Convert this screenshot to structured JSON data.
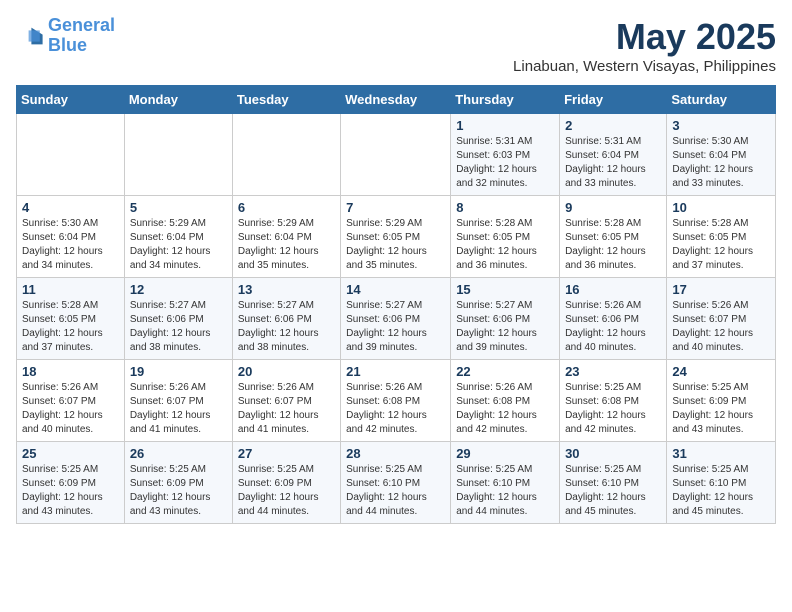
{
  "logo": {
    "line1": "General",
    "line2": "Blue"
  },
  "title": "May 2025",
  "subtitle": "Linabuan, Western Visayas, Philippines",
  "weekdays": [
    "Sunday",
    "Monday",
    "Tuesday",
    "Wednesday",
    "Thursday",
    "Friday",
    "Saturday"
  ],
  "weeks": [
    [
      {
        "day": "",
        "info": ""
      },
      {
        "day": "",
        "info": ""
      },
      {
        "day": "",
        "info": ""
      },
      {
        "day": "",
        "info": ""
      },
      {
        "day": "1",
        "info": "Sunrise: 5:31 AM\nSunset: 6:03 PM\nDaylight: 12 hours\nand 32 minutes."
      },
      {
        "day": "2",
        "info": "Sunrise: 5:31 AM\nSunset: 6:04 PM\nDaylight: 12 hours\nand 33 minutes."
      },
      {
        "day": "3",
        "info": "Sunrise: 5:30 AM\nSunset: 6:04 PM\nDaylight: 12 hours\nand 33 minutes."
      }
    ],
    [
      {
        "day": "4",
        "info": "Sunrise: 5:30 AM\nSunset: 6:04 PM\nDaylight: 12 hours\nand 34 minutes."
      },
      {
        "day": "5",
        "info": "Sunrise: 5:29 AM\nSunset: 6:04 PM\nDaylight: 12 hours\nand 34 minutes."
      },
      {
        "day": "6",
        "info": "Sunrise: 5:29 AM\nSunset: 6:04 PM\nDaylight: 12 hours\nand 35 minutes."
      },
      {
        "day": "7",
        "info": "Sunrise: 5:29 AM\nSunset: 6:05 PM\nDaylight: 12 hours\nand 35 minutes."
      },
      {
        "day": "8",
        "info": "Sunrise: 5:28 AM\nSunset: 6:05 PM\nDaylight: 12 hours\nand 36 minutes."
      },
      {
        "day": "9",
        "info": "Sunrise: 5:28 AM\nSunset: 6:05 PM\nDaylight: 12 hours\nand 36 minutes."
      },
      {
        "day": "10",
        "info": "Sunrise: 5:28 AM\nSunset: 6:05 PM\nDaylight: 12 hours\nand 37 minutes."
      }
    ],
    [
      {
        "day": "11",
        "info": "Sunrise: 5:28 AM\nSunset: 6:05 PM\nDaylight: 12 hours\nand 37 minutes."
      },
      {
        "day": "12",
        "info": "Sunrise: 5:27 AM\nSunset: 6:06 PM\nDaylight: 12 hours\nand 38 minutes."
      },
      {
        "day": "13",
        "info": "Sunrise: 5:27 AM\nSunset: 6:06 PM\nDaylight: 12 hours\nand 38 minutes."
      },
      {
        "day": "14",
        "info": "Sunrise: 5:27 AM\nSunset: 6:06 PM\nDaylight: 12 hours\nand 39 minutes."
      },
      {
        "day": "15",
        "info": "Sunrise: 5:27 AM\nSunset: 6:06 PM\nDaylight: 12 hours\nand 39 minutes."
      },
      {
        "day": "16",
        "info": "Sunrise: 5:26 AM\nSunset: 6:06 PM\nDaylight: 12 hours\nand 40 minutes."
      },
      {
        "day": "17",
        "info": "Sunrise: 5:26 AM\nSunset: 6:07 PM\nDaylight: 12 hours\nand 40 minutes."
      }
    ],
    [
      {
        "day": "18",
        "info": "Sunrise: 5:26 AM\nSunset: 6:07 PM\nDaylight: 12 hours\nand 40 minutes."
      },
      {
        "day": "19",
        "info": "Sunrise: 5:26 AM\nSunset: 6:07 PM\nDaylight: 12 hours\nand 41 minutes."
      },
      {
        "day": "20",
        "info": "Sunrise: 5:26 AM\nSunset: 6:07 PM\nDaylight: 12 hours\nand 41 minutes."
      },
      {
        "day": "21",
        "info": "Sunrise: 5:26 AM\nSunset: 6:08 PM\nDaylight: 12 hours\nand 42 minutes."
      },
      {
        "day": "22",
        "info": "Sunrise: 5:26 AM\nSunset: 6:08 PM\nDaylight: 12 hours\nand 42 minutes."
      },
      {
        "day": "23",
        "info": "Sunrise: 5:25 AM\nSunset: 6:08 PM\nDaylight: 12 hours\nand 42 minutes."
      },
      {
        "day": "24",
        "info": "Sunrise: 5:25 AM\nSunset: 6:09 PM\nDaylight: 12 hours\nand 43 minutes."
      }
    ],
    [
      {
        "day": "25",
        "info": "Sunrise: 5:25 AM\nSunset: 6:09 PM\nDaylight: 12 hours\nand 43 minutes."
      },
      {
        "day": "26",
        "info": "Sunrise: 5:25 AM\nSunset: 6:09 PM\nDaylight: 12 hours\nand 43 minutes."
      },
      {
        "day": "27",
        "info": "Sunrise: 5:25 AM\nSunset: 6:09 PM\nDaylight: 12 hours\nand 44 minutes."
      },
      {
        "day": "28",
        "info": "Sunrise: 5:25 AM\nSunset: 6:10 PM\nDaylight: 12 hours\nand 44 minutes."
      },
      {
        "day": "29",
        "info": "Sunrise: 5:25 AM\nSunset: 6:10 PM\nDaylight: 12 hours\nand 44 minutes."
      },
      {
        "day": "30",
        "info": "Sunrise: 5:25 AM\nSunset: 6:10 PM\nDaylight: 12 hours\nand 45 minutes."
      },
      {
        "day": "31",
        "info": "Sunrise: 5:25 AM\nSunset: 6:10 PM\nDaylight: 12 hours\nand 45 minutes."
      }
    ]
  ]
}
